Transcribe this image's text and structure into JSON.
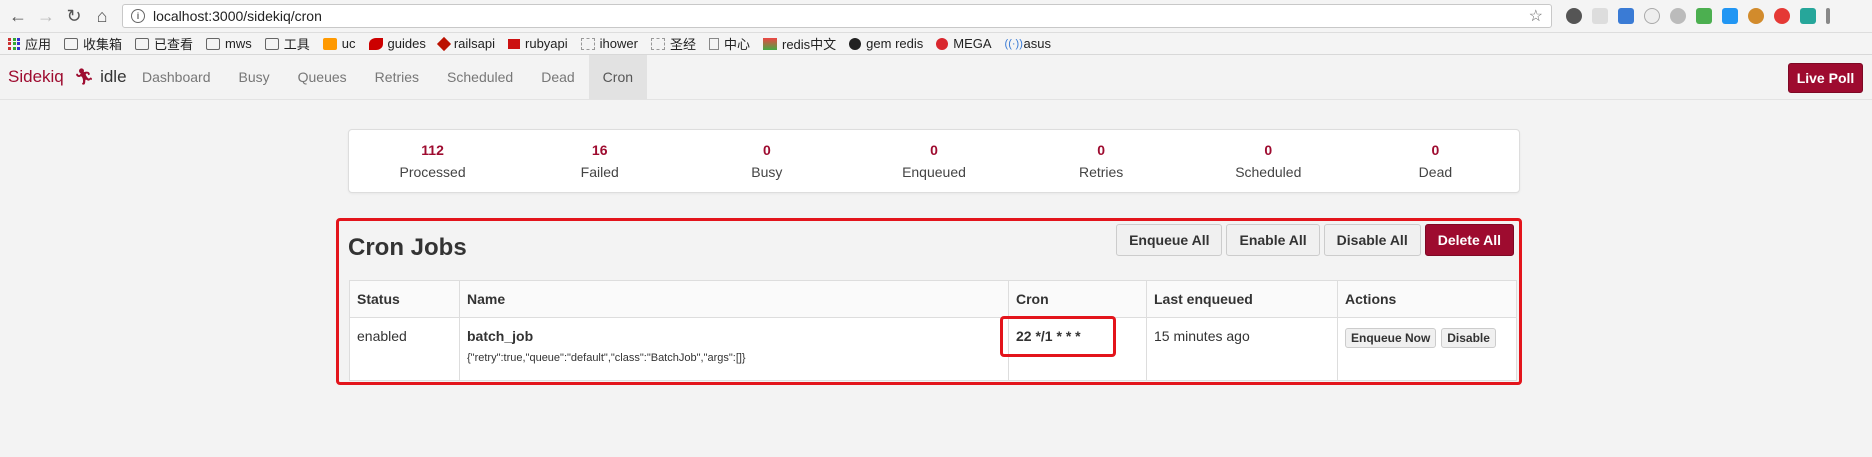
{
  "browser": {
    "url": "localhost:3000/sidekiq/cron",
    "bookmarks": [
      {
        "label": "应用",
        "icon": "apps-grid-icon"
      },
      {
        "label": "收集箱",
        "icon": "folder-icon"
      },
      {
        "label": "已查看",
        "icon": "folder-icon"
      },
      {
        "label": "mws",
        "icon": "folder-icon"
      },
      {
        "label": "工具",
        "icon": "folder-icon"
      },
      {
        "label": "uc",
        "icon": "uc-icon"
      },
      {
        "label": "guides",
        "icon": "rails-icon"
      },
      {
        "label": "railsapi",
        "icon": "ruby-icon"
      },
      {
        "label": "rubyapi",
        "icon": "ruby-icon"
      },
      {
        "label": "ihower",
        "icon": "page-icon"
      },
      {
        "label": "圣经",
        "icon": "page-icon"
      },
      {
        "label": "中心",
        "icon": "page-icon"
      },
      {
        "label": "redis中文",
        "icon": "redis-icon"
      },
      {
        "label": "gem redis",
        "icon": "github-icon"
      },
      {
        "label": "MEGA",
        "icon": "mega-icon"
      },
      {
        "label": "asus",
        "icon": "wifi-icon"
      }
    ]
  },
  "nav": {
    "brand": "Sidekiq",
    "status": "idle",
    "links": [
      "Dashboard",
      "Busy",
      "Queues",
      "Retries",
      "Scheduled",
      "Dead",
      "Cron"
    ],
    "active": "Cron",
    "live_poll": "Live Poll"
  },
  "summary": [
    {
      "value": "112",
      "label": "Processed"
    },
    {
      "value": "16",
      "label": "Failed"
    },
    {
      "value": "0",
      "label": "Busy"
    },
    {
      "value": "0",
      "label": "Enqueued"
    },
    {
      "value": "0",
      "label": "Retries"
    },
    {
      "value": "0",
      "label": "Scheduled"
    },
    {
      "value": "0",
      "label": "Dead"
    }
  ],
  "cron": {
    "title": "Cron Jobs",
    "buttons": {
      "enqueue_all": "Enqueue All",
      "enable_all": "Enable All",
      "disable_all": "Disable All",
      "delete_all": "Delete All"
    },
    "columns": [
      "Status",
      "Name",
      "Cron",
      "Last enqueued",
      "Actions"
    ],
    "rows": [
      {
        "status": "enabled",
        "name": "batch_job",
        "args": "{\"retry\":true,\"queue\":\"default\",\"class\":\"BatchJob\",\"args\":[]}",
        "cron": "22 */1 * * *",
        "last_enqueued": "15 minutes ago",
        "actions": {
          "enqueue_now": "Enqueue Now",
          "disable": "Disable"
        }
      }
    ]
  },
  "colors": {
    "brand": "#9e0b2f",
    "highlight": "#e3141b"
  }
}
